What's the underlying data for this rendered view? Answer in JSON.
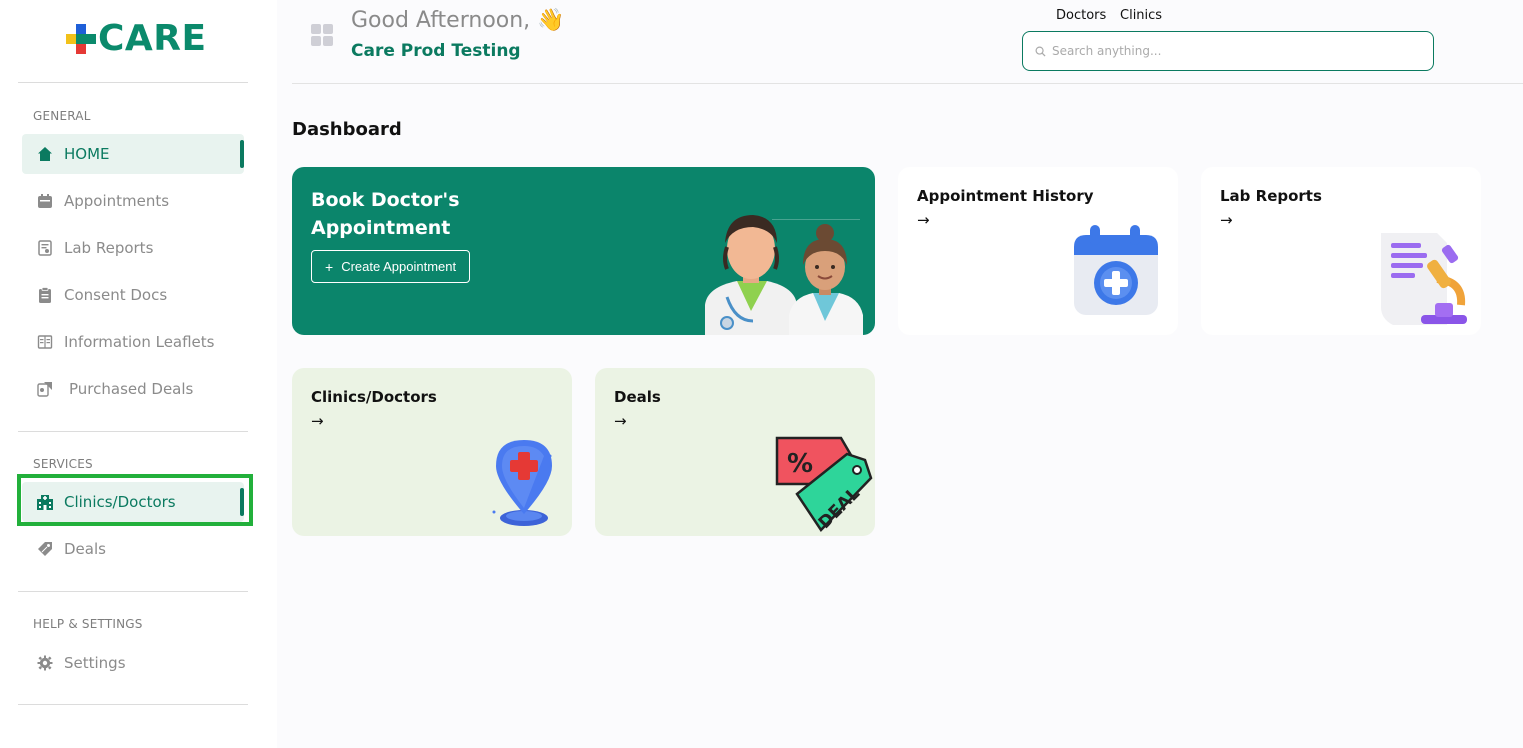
{
  "brand": {
    "name": "CARE"
  },
  "sidebar": {
    "sections": [
      {
        "label": "GENERAL"
      },
      {
        "label": "SERVICES"
      },
      {
        "label": "HELP & SETTINGS"
      }
    ],
    "items": [
      {
        "label": "HOME",
        "icon": "home-icon",
        "active": true
      },
      {
        "label": "Appointments",
        "icon": "calendar-icon"
      },
      {
        "label": "Lab Reports",
        "icon": "lab-report-icon"
      },
      {
        "label": "Consent Docs",
        "icon": "clipboard-icon"
      },
      {
        "label": "Information Leaflets",
        "icon": "leaflet-icon"
      },
      {
        "label": "Purchased Deals",
        "icon": "purchased-deals-icon"
      },
      {
        "label": "Clinics/Doctors",
        "icon": "hospital-icon",
        "active": true
      },
      {
        "label": "Deals",
        "icon": "tag-icon"
      },
      {
        "label": "Settings",
        "icon": "gear-icon"
      }
    ]
  },
  "header": {
    "greeting": "Good Afternoon, 👋",
    "org_name": "Care Prod Testing",
    "links": [
      "Doctors",
      "Clinics"
    ],
    "search_placeholder": "Search anything..."
  },
  "main": {
    "title": "Dashboard",
    "book_card": {
      "title": "Book Doctor's Appointment",
      "button_label": "Create Appointment"
    },
    "cards": [
      {
        "title": "Appointment History",
        "arrow": "→"
      },
      {
        "title": "Lab Reports",
        "arrow": "→"
      },
      {
        "title": "Clinics/Doctors",
        "arrow": "→"
      },
      {
        "title": "Deals",
        "arrow": "→"
      }
    ]
  },
  "colors": {
    "brand_green": "#0b856b",
    "active_bg": "#e8f3ef",
    "card_light_green": "#ebf3e4",
    "highlight_outline": "#22b03b"
  }
}
